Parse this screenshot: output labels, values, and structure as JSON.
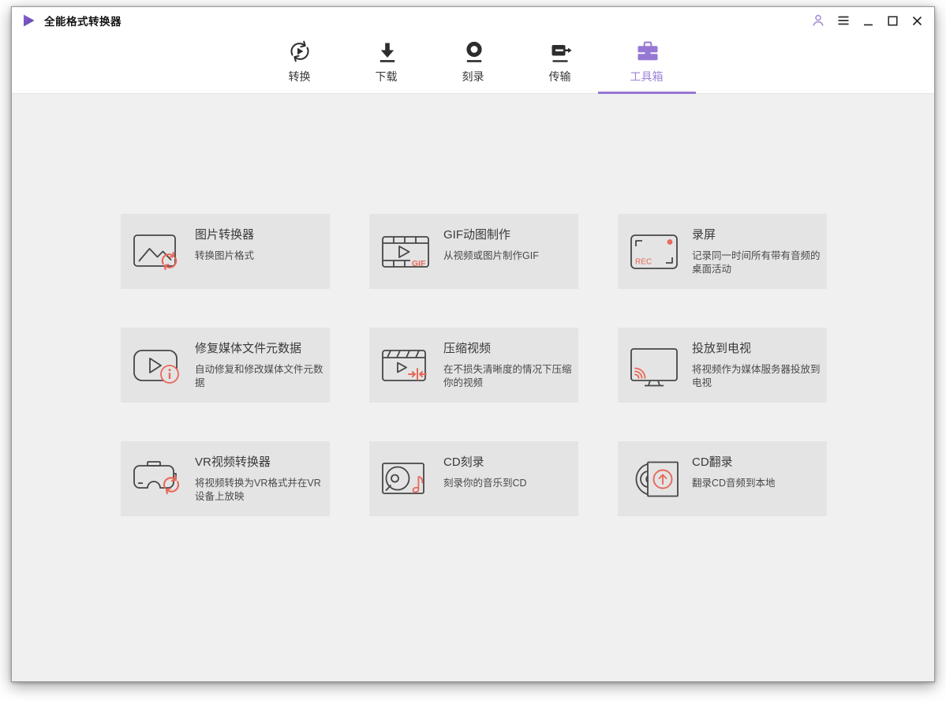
{
  "window": {
    "title": "全能格式转换器",
    "controls": {
      "account": "user-account",
      "menu": "main-menu",
      "minimize": "minimize",
      "maximize": "maximize",
      "close": "close"
    }
  },
  "nav": {
    "tabs": [
      {
        "label": "转换",
        "icon": "convert-icon",
        "active": false
      },
      {
        "label": "下载",
        "icon": "download-icon",
        "active": false
      },
      {
        "label": "刻录",
        "icon": "burn-icon",
        "active": false
      },
      {
        "label": "传输",
        "icon": "transfer-icon",
        "active": false
      },
      {
        "label": "工具箱",
        "icon": "toolbox-icon",
        "active": true
      }
    ]
  },
  "toolbox": {
    "cards": [
      {
        "icon": "image-converter",
        "title": "图片转换器",
        "desc": "转换图片格式"
      },
      {
        "icon": "gif-maker",
        "title": "GIF动图制作",
        "desc": "从视频或图片制作GIF"
      },
      {
        "icon": "screen-recorder",
        "title": "录屏",
        "desc": "记录同一时间所有带有音频的桌面活动"
      },
      {
        "icon": "metadata-fixer",
        "title": "修复媒体文件元数据",
        "desc": "自动修复和修改媒体文件元数据"
      },
      {
        "icon": "video-compressor",
        "title": "压缩视频",
        "desc": "在不损失清晰度的情况下压缩你的视频"
      },
      {
        "icon": "cast-to-tv",
        "title": "投放到电视",
        "desc": "将视频作为媒体服务器投放到电视"
      },
      {
        "icon": "vr-converter",
        "title": "VR视频转换器",
        "desc": "将视频转换为VR格式并在VR设备上放映"
      },
      {
        "icon": "cd-burner",
        "title": "CD刻录",
        "desc": "刻录你的音乐到CD"
      },
      {
        "icon": "cd-ripper",
        "title": "CD翻录",
        "desc": "翻录CD音频到本地"
      }
    ],
    "icon_labels": {
      "gif": "GIF",
      "rec": "REC"
    }
  },
  "colors": {
    "accent_purple": "#9678d4",
    "accent_coral": "#e8685a"
  }
}
